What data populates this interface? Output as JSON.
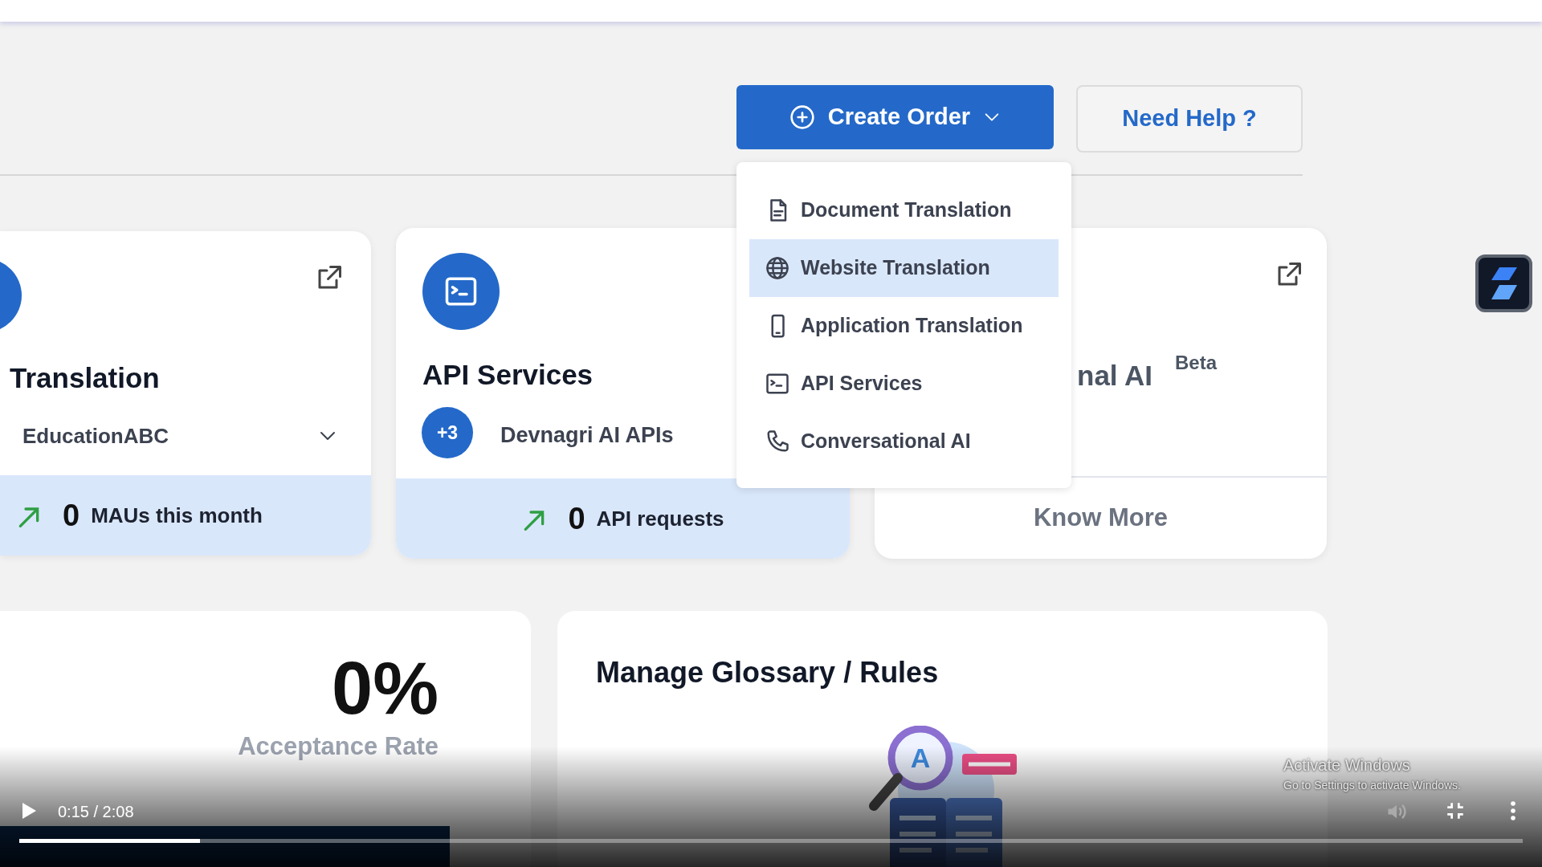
{
  "header": {
    "create_button": {
      "label": "Create Order",
      "expanded": true
    },
    "help_button": {
      "label": "Need Help ?"
    }
  },
  "create_menu": [
    {
      "kind": "document",
      "label": "Document Translation",
      "selected": false
    },
    {
      "kind": "globe",
      "label": "Website Translation",
      "selected": true
    },
    {
      "kind": "phone",
      "label": "Application Translation",
      "selected": false
    },
    {
      "kind": "terminal",
      "label": "API Services",
      "selected": false
    },
    {
      "kind": "handset",
      "label": "Conversational AI",
      "selected": false
    }
  ],
  "cards": [
    {
      "kind": "project",
      "title": "Translation",
      "select_value": "EducationABC",
      "stat_value": "0",
      "stat_label": "MAUs this month"
    },
    {
      "kind": "api",
      "title": "API Services",
      "badge": "+3",
      "subtitle": "Devnagri AI APIs",
      "stat_value": "0",
      "stat_label": "API requests"
    },
    {
      "kind": "beta",
      "title": "nal AI",
      "tag": "Beta",
      "link": "Know More"
    }
  ],
  "acceptance": {
    "value": "0%",
    "label": "Acceptance Rate"
  },
  "glossary": {
    "title": "Manage Glossary / Rules",
    "illustration_letter": "A"
  },
  "os_notice": {
    "title": "Activate Windows",
    "subtitle": "Go to Settings to activate Windows."
  },
  "video_player": {
    "time": "0:15 / 2:08",
    "level": 0.12,
    "playing": false
  }
}
